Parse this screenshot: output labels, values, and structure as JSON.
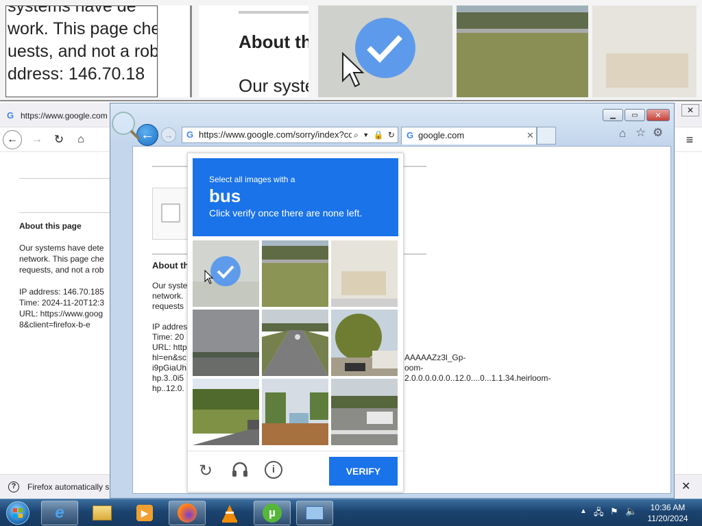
{
  "zoom_strip": {
    "left_lines": [
      "systems have de",
      "work. This page che",
      "uests, and not a rob",
      "",
      "ddress: 146.70.18"
    ],
    "mid_title": "About th",
    "mid_text": "Our syste"
  },
  "firefox": {
    "tab_title": "https://www.google.com",
    "content": {
      "heading": "About this page",
      "para_lines": [
        "Our systems have dete",
        "network. This page che",
        "requests, and not a rob"
      ],
      "ip": "IP address: 146.70.185",
      "time": "Time: 2024-11-20T12:3",
      "url_lines": [
        "URL: https://www.goog",
        "8&client=firefox-b-e"
      ]
    },
    "notification": "Firefox automatically s"
  },
  "ie": {
    "address": "https://www.google.com/sorry/index?cor",
    "tab_title": "google.com",
    "page": {
      "heading": "About th",
      "para_lines": [
        "Our syste",
        "network.",
        "requests"
      ],
      "ip": "IP addres",
      "time": "Time: 20",
      "url_lines": [
        "URL: http",
        "hl=en&sc",
        "i9pGiaUh",
        "hp.3..0i5",
        "hp..12.0."
      ],
      "right_lines": [
        "AAAAAZz3l_Gp-",
        "oom-",
        "2.0.0.0.0.0.0..12.0....0...1.1.34.heirloom-"
      ]
    }
  },
  "captcha": {
    "instruction": "Select all images with a",
    "target": "bus",
    "subtext": "Click verify once there are none left.",
    "verify_label": "VERIFY",
    "tiles": [
      {
        "name": "tile-1",
        "selected": true
      },
      {
        "name": "tile-2",
        "selected": false
      },
      {
        "name": "tile-3",
        "selected": false
      },
      {
        "name": "tile-4",
        "selected": false
      },
      {
        "name": "tile-5",
        "selected": false
      },
      {
        "name": "tile-6",
        "selected": false
      },
      {
        "name": "tile-7",
        "selected": false
      },
      {
        "name": "tile-8",
        "selected": false
      },
      {
        "name": "tile-9",
        "selected": false
      }
    ]
  },
  "taskbar": {
    "time": "10:36 AM",
    "date": "11/20/2024"
  },
  "colors": {
    "captcha_blue": "#1a73e8",
    "taskbar": "#1c4470"
  }
}
